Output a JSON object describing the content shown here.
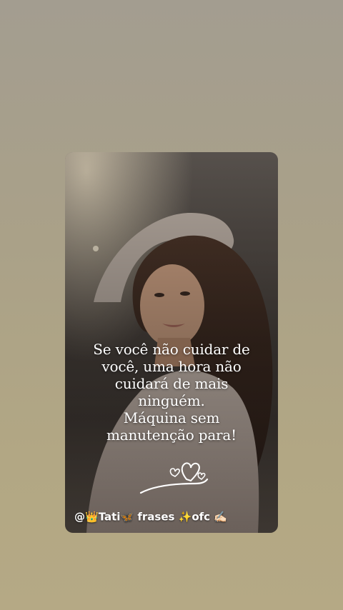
{
  "post": {
    "quote_lines": [
      "Se você não cuidar de",
      "você, uma hora não",
      "cuidará de mais",
      "ninguém.",
      "Máquina sem",
      "manutenção para!"
    ],
    "handle": {
      "prefix": "@",
      "crown_icon": "👑",
      "name": "Tati",
      "butterfly_icon": "🦋",
      "word": "frases",
      "sparkle_icon": "✨",
      "suffix": "ofc",
      "writing_hand_icon": "✍🏻"
    }
  },
  "colors": {
    "background": "#aaa188",
    "quote_text": "#ffffff"
  }
}
